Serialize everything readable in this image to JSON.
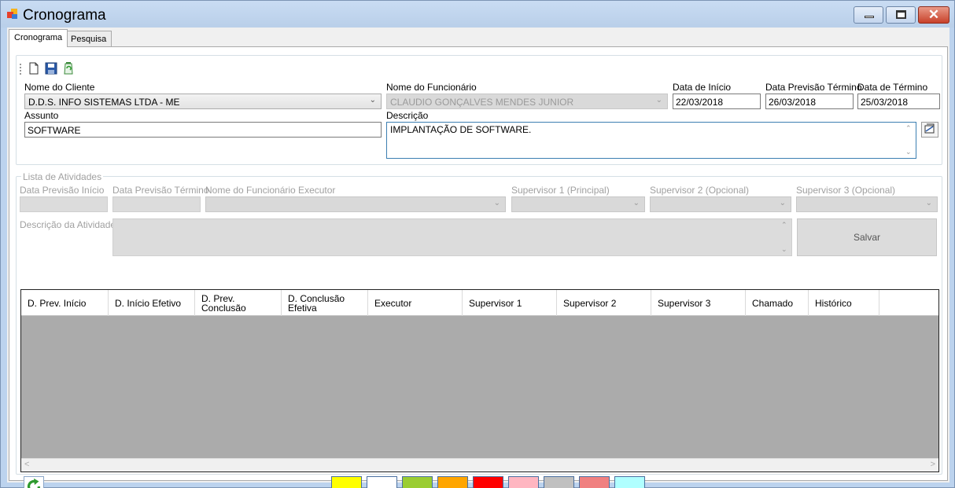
{
  "window": {
    "title": "Cronograma",
    "buttons": {
      "minimize": "minimize",
      "maximize": "maximize",
      "close": "✕"
    }
  },
  "tabs": [
    {
      "label": "Cronograma",
      "active": true
    },
    {
      "label": "Pesquisa",
      "active": false
    }
  ],
  "toolbar": {
    "icons": [
      "new-document-icon",
      "save-icon",
      "recycle-icon"
    ]
  },
  "header_form": {
    "cliente": {
      "label": "Nome do  Cliente",
      "value": "D.D.S. INFO SISTEMAS LTDA - ME"
    },
    "funcionario": {
      "label": "Nome do Funcionário",
      "value": "CLAUDIO GONÇALVES MENDES JUNIOR"
    },
    "data_inicio": {
      "label": "Data de Início",
      "value": "22/03/2018"
    },
    "data_previsao_termino": {
      "label": "Data Previsão Término",
      "value": "26/03/2018"
    },
    "data_termino": {
      "label": "Data de Término",
      "value": "25/03/2018"
    },
    "assunto": {
      "label": "Assunto",
      "value": "SOFTWARE"
    },
    "descricao": {
      "label": "Descrição",
      "value": "IMPLANTAÇÃO DE SOFTWARE."
    }
  },
  "atividades": {
    "group_label": "Lista de Atividades",
    "data_previsao_inicio": {
      "label": "Data Previsão Início",
      "value": ""
    },
    "data_previsao_termino": {
      "label": "Data Previsão Término",
      "value": ""
    },
    "funcionario_executor": {
      "label": "Nome do Funcionário Executor",
      "value": ""
    },
    "supervisor1": {
      "label": "Supervisor 1 (Principal)",
      "value": ""
    },
    "supervisor2": {
      "label": "Supervisor 2 (Opcional)",
      "value": ""
    },
    "supervisor3": {
      "label": "Supervisor 3 (Opcional)",
      "value": ""
    },
    "descricao": {
      "label": "Descrição da Atividade",
      "value": ""
    },
    "salvar_label": "Salvar"
  },
  "grid": {
    "columns": [
      "D. Prev. Início",
      "D. Início Efetivo",
      "D. Prev. Conclusão",
      "D. Conclusão Efetiva",
      "Executor",
      "Supervisor 1",
      "Supervisor 2",
      "Supervisor 3",
      "Chamado",
      "Histórico"
    ],
    "rows": []
  },
  "legend_colors": [
    "#ffff00",
    "#ffffff",
    "#9acd32",
    "#ffa500",
    "#ff0000",
    "#ffb6c1",
    "#c0c0c0",
    "#f08080",
    "#b0ffff"
  ],
  "accent": "#3c7fb1"
}
